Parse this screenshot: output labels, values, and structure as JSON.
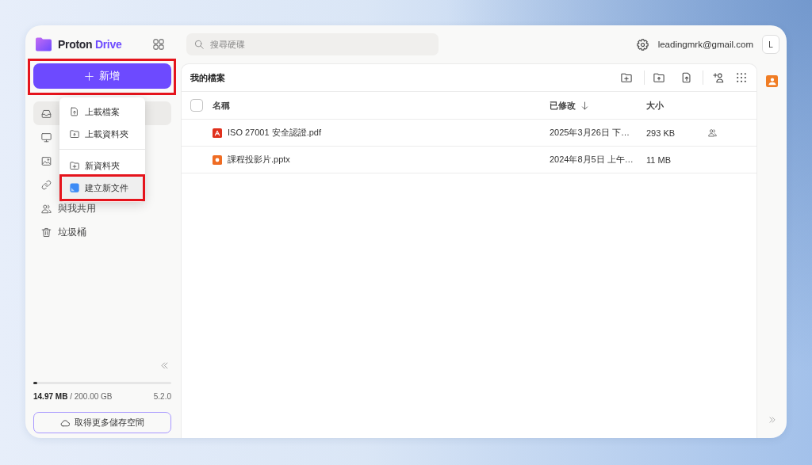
{
  "logo": {
    "name": "Proton",
    "product": "Drive"
  },
  "new_button": {
    "label": "新增",
    "highlighted": true
  },
  "sidebar": {
    "items": [
      {
        "selected": true
      },
      {
        "selected": false
      },
      {
        "selected": false
      },
      {
        "selected": false
      },
      {
        "label": "與我共用",
        "selected": false
      },
      {
        "label": "垃圾桶",
        "selected": false
      }
    ]
  },
  "new_menu": {
    "groups": [
      [
        {
          "label": "上載檔案",
          "selected": false,
          "highlighted": false
        },
        {
          "label": "上載資料夾",
          "selected": false,
          "highlighted": false
        }
      ],
      [
        {
          "label": "新資料夾",
          "selected": false,
          "highlighted": false
        },
        {
          "label": "建立新文件",
          "selected": true,
          "highlighted": true
        }
      ]
    ]
  },
  "storage": {
    "usage": "**14.97 MB** / 200.00 GB",
    "level": 0.03,
    "version": "5.2.0"
  },
  "upgrade_button": {
    "label": "取得更多儲存空間"
  },
  "search": {
    "placeholder": "搜尋硬碟"
  },
  "account": {
    "email": "leadingmrk@gmail.com",
    "initial": "L"
  },
  "files": {
    "title": "我的檔案",
    "select_all": {
      "checked": false
    },
    "columns": [
      {
        "label": "名稱",
        "sorted": false
      },
      {
        "label": "已修改",
        "sorted": true
      },
      {
        "label": "大小",
        "sorted": false
      }
    ],
    "rows": [
      {
        "kind": "pdf",
        "name": "ISO 27001 安全認證.pdf",
        "modified": "2025年3月26日 下…",
        "size": "293 KB",
        "shared": true
      },
      {
        "kind": "pptx",
        "name": "課程投影片.pptx",
        "modified": "2024年8月5日 上午…",
        "size": "11 MB",
        "shared": false
      }
    ]
  }
}
